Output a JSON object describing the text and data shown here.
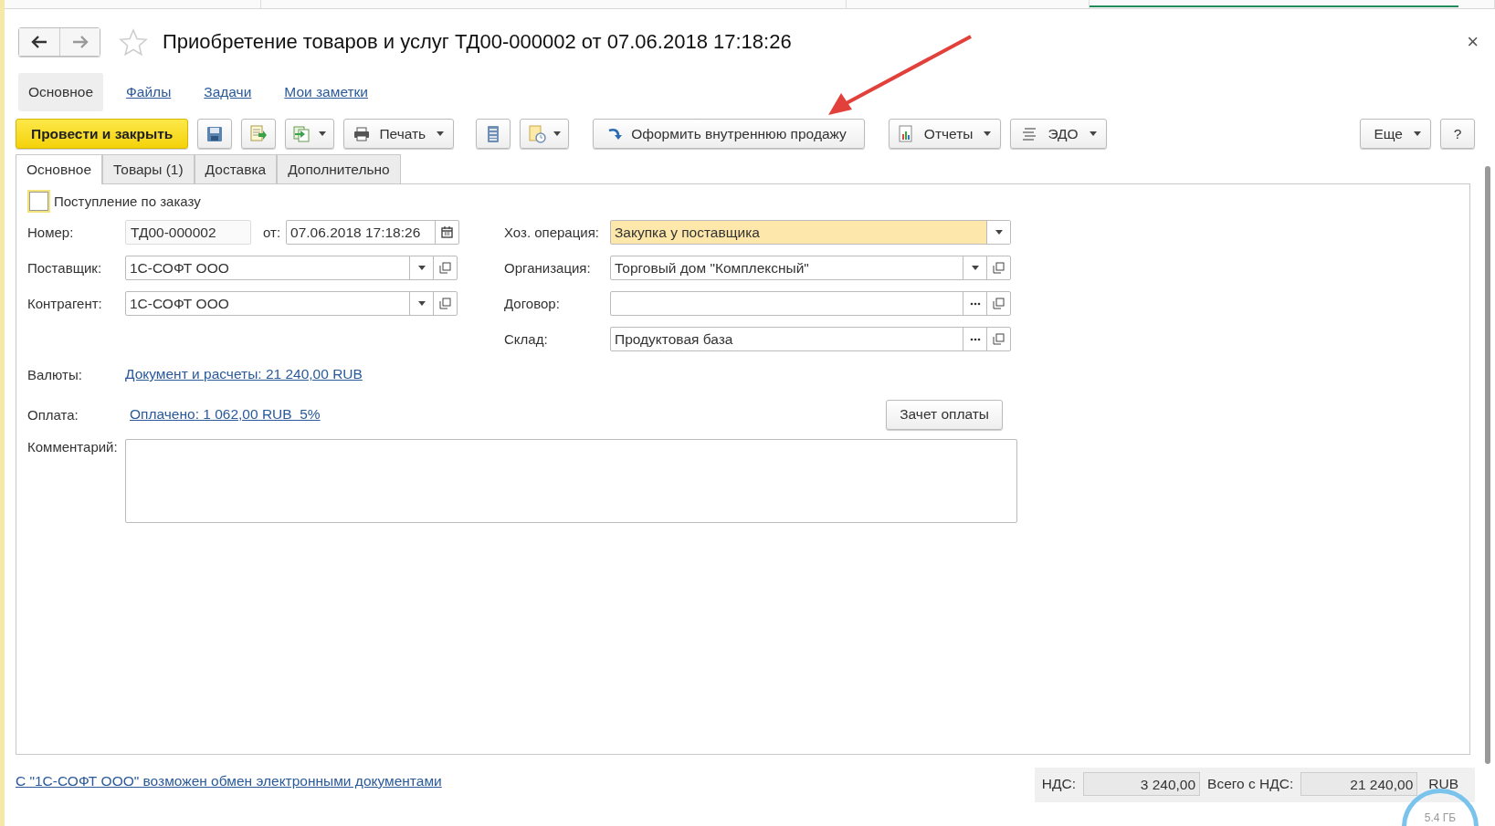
{
  "window": {
    "title": "Приобретение товаров и услуг ТД00-000002 от 07.06.2018 17:18:26",
    "close": "×"
  },
  "nav": [
    {
      "label": "Основное",
      "selected": true
    },
    {
      "label": "Файлы",
      "selected": false
    },
    {
      "label": "Задачи",
      "selected": false
    },
    {
      "label": "Мои заметки",
      "selected": false
    }
  ],
  "toolbar": {
    "post_button": "Провести и закрыть",
    "print": "Печать",
    "internal_sale": "Оформить внутреннюю продажу",
    "reports": "Отчеты",
    "edo": "ЭДО",
    "more": "Еще",
    "help": "?"
  },
  "tabs": [
    {
      "label": "Основное",
      "selected": true
    },
    {
      "label": "Товары (1)",
      "selected": false
    },
    {
      "label": "Доставка",
      "selected": false
    },
    {
      "label": "Дополнительно",
      "selected": false
    }
  ],
  "form": {
    "order_checkbox": {
      "label": "Поступление по заказу",
      "checked": false
    },
    "number": {
      "label": "Номер:",
      "value": "ТД00-000002"
    },
    "date": {
      "label": "от:",
      "value": "07.06.2018 17:18:26"
    },
    "supplier": {
      "label": "Поставщик:",
      "value": "1С-СОФТ ООО"
    },
    "counterparty": {
      "label": "Контрагент:",
      "value": "1С-СОФТ ООО"
    },
    "operation": {
      "label": "Хоз. операция:",
      "value": "Закупка у поставщика"
    },
    "organization": {
      "label": "Организация:",
      "value": "Торговый дом \"Комплексный\""
    },
    "contract": {
      "label": "Договор:"
    },
    "warehouse": {
      "label": "Склад:",
      "value": "Продуктовая база"
    },
    "currency": {
      "label": "Валюты:",
      "link": "Документ и расчеты: 21 240,00 RUB"
    },
    "payment": {
      "label": "Оплата:",
      "link": "Оплачено: 1 062,00 RUB  5%"
    },
    "offset_button": "Зачет оплаты",
    "comment": {
      "label": "Комментарий:"
    }
  },
  "footer": {
    "edo_link": "С \"1С-СОФТ ООО\" возможен обмен электронными документами",
    "vat_label": "НДС:",
    "vat": "3 240,00",
    "total_label": "Всего с НДС:",
    "total": "21 240,00",
    "currency": "RUB"
  },
  "overlay": {
    "memory": "5.4 ГБ"
  }
}
